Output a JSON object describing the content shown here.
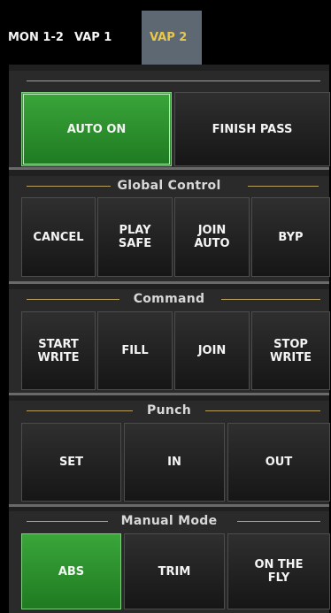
{
  "tabs": [
    {
      "label": "MON 1-2",
      "active": false
    },
    {
      "label": "VAP 1",
      "active": false
    },
    {
      "label": "VAP 2",
      "active": true
    }
  ],
  "top": {
    "buttons": [
      {
        "label": "AUTO ON",
        "active": true
      },
      {
        "label": "FINISH PASS",
        "active": false
      }
    ]
  },
  "global_control": {
    "title": "Global Control",
    "buttons": [
      "CANCEL",
      "PLAY\nSAFE",
      "JOIN\nAUTO",
      "BYP"
    ]
  },
  "command": {
    "title": "Command",
    "buttons": [
      "START\nWRITE",
      "FILL",
      "JOIN",
      "STOP\nWRITE"
    ]
  },
  "punch": {
    "title": "Punch",
    "buttons": [
      "SET",
      "IN",
      "OUT"
    ]
  },
  "manual_mode": {
    "title": "Manual Mode",
    "buttons": [
      {
        "label": "ABS",
        "active": true
      },
      {
        "label": "TRIM",
        "active": false
      },
      {
        "label": "ON THE\nFLY",
        "active": false
      }
    ]
  },
  "colors": {
    "active_green": "#2e9a2f",
    "tab_active_bg": "#5d6873",
    "tab_active_text": "#e8c84a",
    "rule_gold": "#b8a160"
  }
}
